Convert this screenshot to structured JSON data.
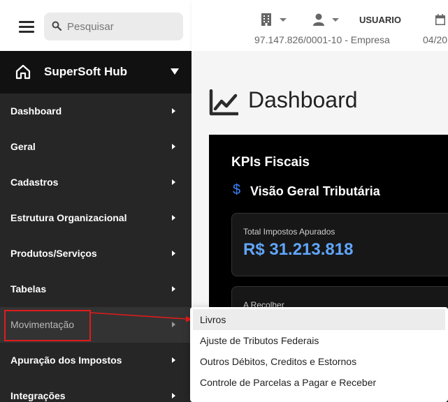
{
  "search": {
    "placeholder": "Pesquisar"
  },
  "brand": {
    "name": "SuperSoft Hub"
  },
  "sidebar": {
    "items": [
      {
        "label": "Dashboard",
        "active": false
      },
      {
        "label": "Geral",
        "active": false
      },
      {
        "label": "Cadastros",
        "active": false
      },
      {
        "label": "Estrutura Organizacional",
        "active": false
      },
      {
        "label": "Produtos/Serviços",
        "active": false
      },
      {
        "label": "Tabelas",
        "active": false
      },
      {
        "label": "Movimentação",
        "active": true
      },
      {
        "label": "Apuração dos Impostos",
        "active": false
      },
      {
        "label": "Integrações",
        "active": false
      }
    ]
  },
  "header": {
    "user_label": "USUARIO",
    "company": "97.147.826/0001-10 - Empresa",
    "date": "04/20"
  },
  "page": {
    "title": "Dashboard"
  },
  "kpi": {
    "title": "KPIs Fiscais",
    "subtitle": "Visão Geral Tributária",
    "dollar_glyph": "$",
    "metrics": [
      {
        "label": "Total Impostos Apurados",
        "value": "R$ 31.213.818"
      },
      {
        "label": "A Recolher",
        "value": ""
      }
    ]
  },
  "submenu": {
    "items": [
      {
        "label": "Livros",
        "hover": true
      },
      {
        "label": "Ajuste de Tributos Federais",
        "hover": false
      },
      {
        "label": "Outros Débitos, Creditos e Estornos",
        "hover": false
      },
      {
        "label": "Controle de Parcelas a Pagar e Receber",
        "hover": false
      }
    ]
  },
  "colors": {
    "sidebar_bg": "#262626",
    "brand_bg": "#111111",
    "accent_blue": "#60a5fa",
    "annotation_red": "#e01b1b"
  }
}
